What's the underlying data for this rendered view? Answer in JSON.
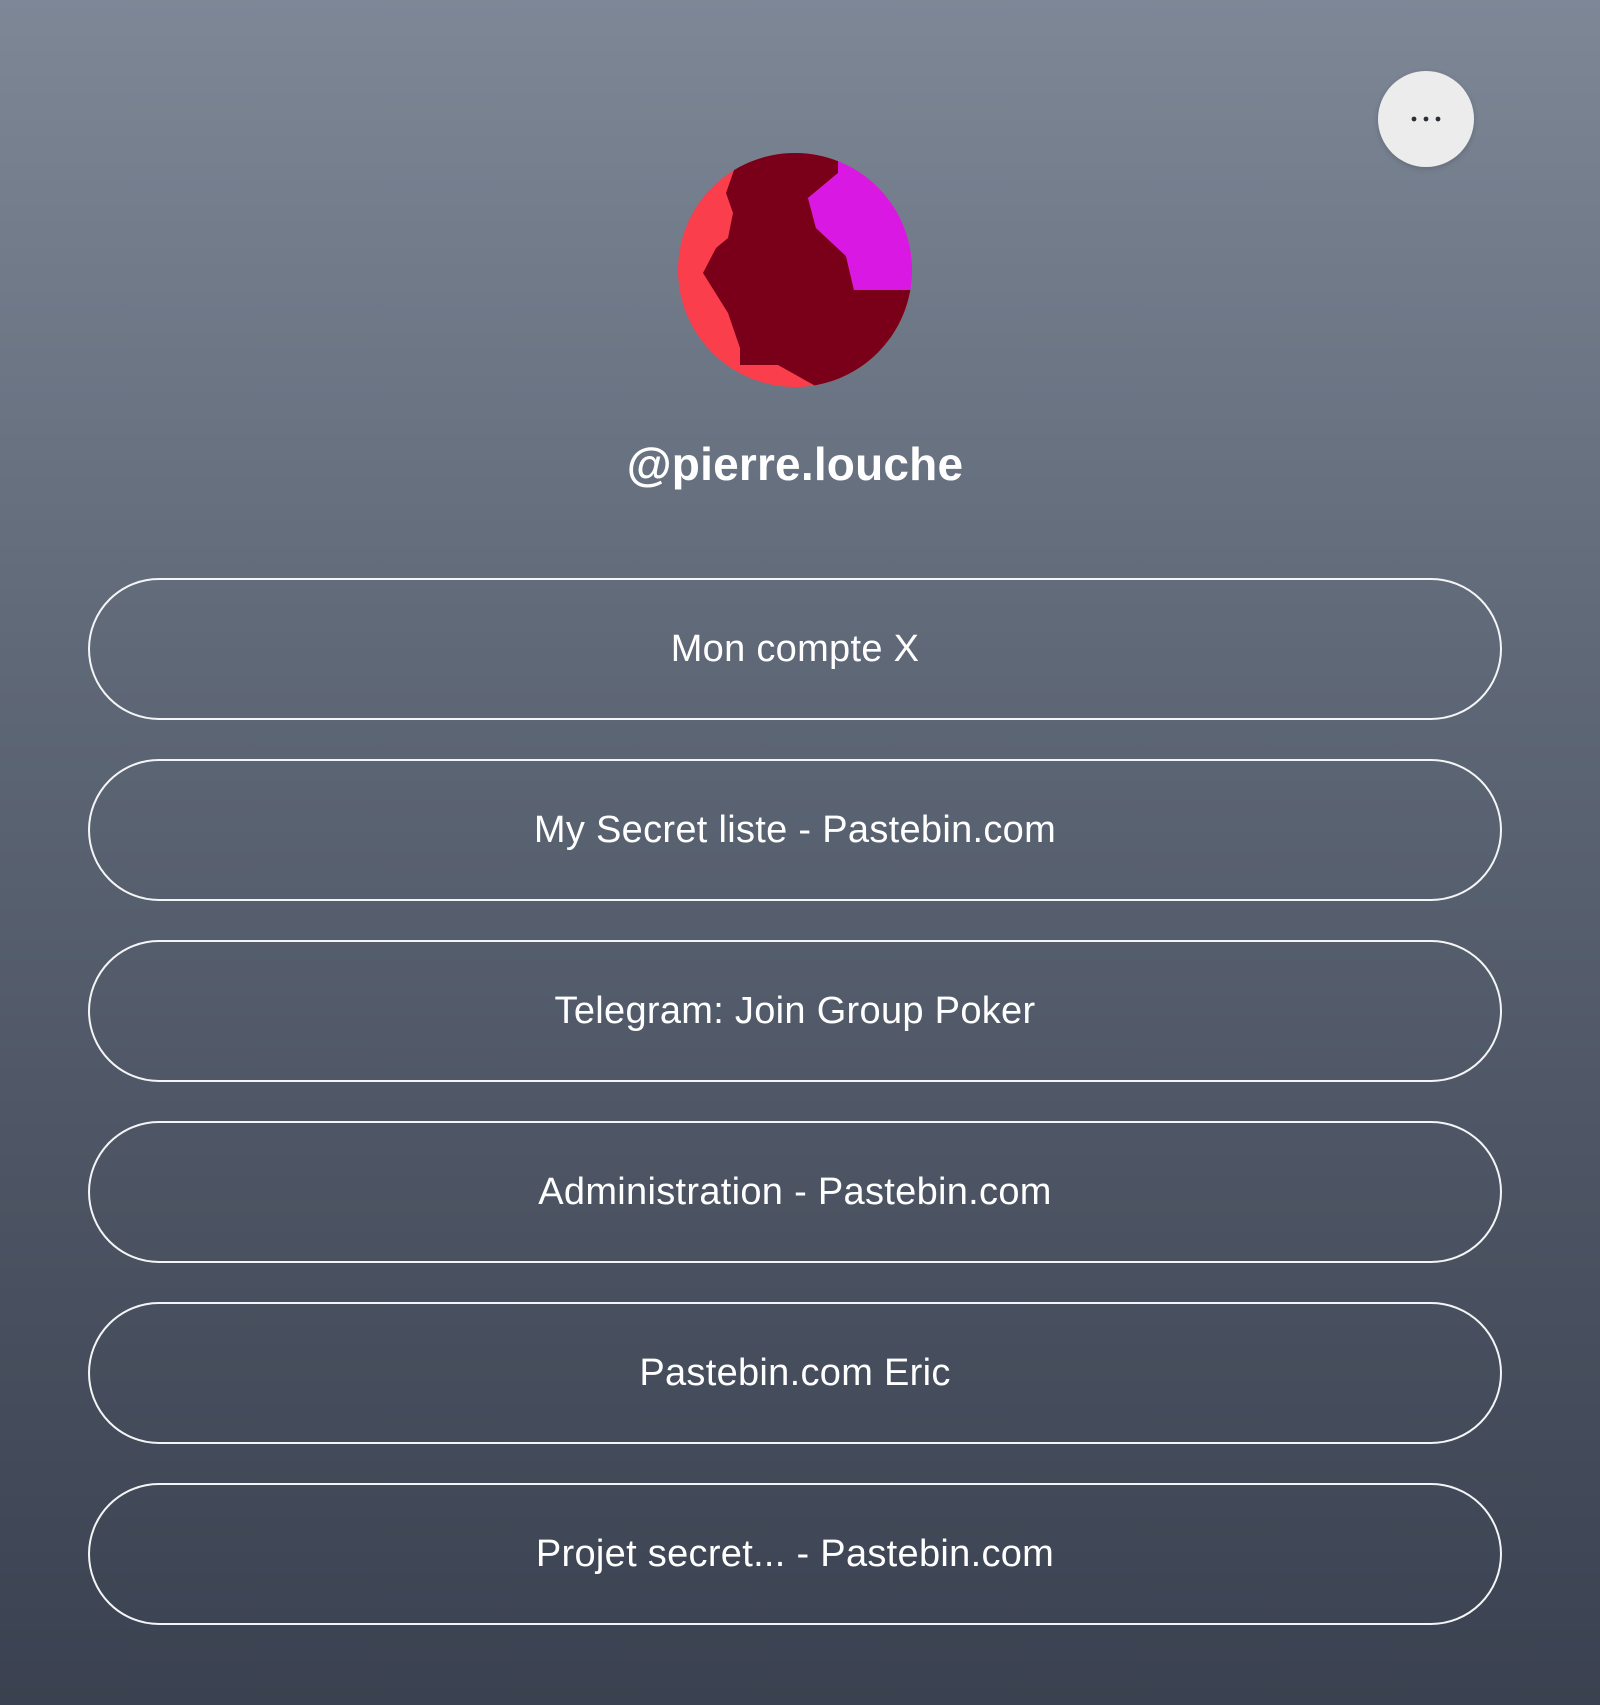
{
  "profile": {
    "handle": "@pierre.louche",
    "avatar_colors": [
      "#fb3e4c",
      "#790018",
      "#d918e4"
    ]
  },
  "header": {
    "more_icon": "more-horizontal-icon"
  },
  "links": [
    {
      "label": "Mon compte X"
    },
    {
      "label": "My Secret liste - Pastebin.com"
    },
    {
      "label": "Telegram: Join Group Poker"
    },
    {
      "label": "Administration - Pastebin.com"
    },
    {
      "label": "Pastebin.com Eric"
    },
    {
      "label": "Projet secret... - Pastebin.com"
    }
  ]
}
